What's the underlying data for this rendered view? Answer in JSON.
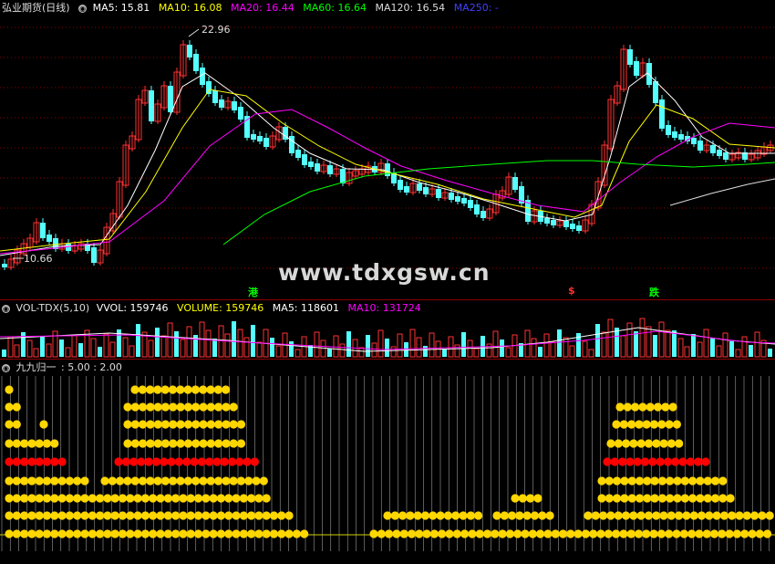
{
  "price_panel": {
    "title": "弘业期货(日线)",
    "ma": [
      {
        "label": "MA5: 15.81",
        "color": "#ffffff"
      },
      {
        "label": "MA10: 16.08",
        "color": "#ffff00"
      },
      {
        "label": "MA20: 16.44",
        "color": "#ff00ff"
      },
      {
        "label": "MA60: 16.64",
        "color": "#00ff00"
      },
      {
        "label": "MA120: 16.54",
        "color": "#dddddd"
      },
      {
        "label": "MA250: -",
        "color": "#4040ff"
      }
    ],
    "high_label": "22.96",
    "low_label": "10.66",
    "markers": [
      {
        "text": "港",
        "color": "#00ff00"
      },
      {
        "text": "$",
        "color": "#ff3030"
      },
      {
        "text": "跌",
        "color": "#00ff00"
      }
    ],
    "watermark": "www.tdxgsw.cn"
  },
  "volume_panel": {
    "title": "VOL-TDX(5,10)",
    "items": [
      {
        "label": "VVOL: 159746",
        "color": "#ffffff"
      },
      {
        "label": "VOLUME: 159746",
        "color": "#ffff00"
      },
      {
        "label": "MA5: 118601",
        "color": "#ffffff"
      },
      {
        "label": "MA10: 131724",
        "color": "#ff00ff"
      }
    ]
  },
  "indicator_panel": {
    "title": "九九归一",
    "params": ": 5.00 : 2.00"
  },
  "colors": {
    "up": "#ff3232",
    "down": "#54ffff",
    "grid": "#8b0000",
    "dot": "#ffd700",
    "dot_red": "#ff0000"
  }
}
